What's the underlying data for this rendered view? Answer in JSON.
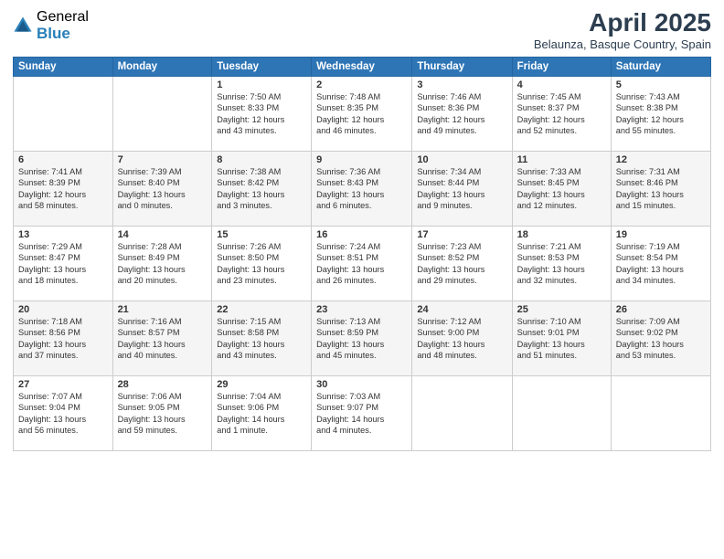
{
  "header": {
    "logo_general": "General",
    "logo_blue": "Blue",
    "month_year": "April 2025",
    "location": "Belaunza, Basque Country, Spain"
  },
  "weekdays": [
    "Sunday",
    "Monday",
    "Tuesday",
    "Wednesday",
    "Thursday",
    "Friday",
    "Saturday"
  ],
  "weeks": [
    [
      {
        "day": "",
        "info": ""
      },
      {
        "day": "",
        "info": ""
      },
      {
        "day": "1",
        "info": "Sunrise: 7:50 AM\nSunset: 8:33 PM\nDaylight: 12 hours\nand 43 minutes."
      },
      {
        "day": "2",
        "info": "Sunrise: 7:48 AM\nSunset: 8:35 PM\nDaylight: 12 hours\nand 46 minutes."
      },
      {
        "day": "3",
        "info": "Sunrise: 7:46 AM\nSunset: 8:36 PM\nDaylight: 12 hours\nand 49 minutes."
      },
      {
        "day": "4",
        "info": "Sunrise: 7:45 AM\nSunset: 8:37 PM\nDaylight: 12 hours\nand 52 minutes."
      },
      {
        "day": "5",
        "info": "Sunrise: 7:43 AM\nSunset: 8:38 PM\nDaylight: 12 hours\nand 55 minutes."
      }
    ],
    [
      {
        "day": "6",
        "info": "Sunrise: 7:41 AM\nSunset: 8:39 PM\nDaylight: 12 hours\nand 58 minutes."
      },
      {
        "day": "7",
        "info": "Sunrise: 7:39 AM\nSunset: 8:40 PM\nDaylight: 13 hours\nand 0 minutes."
      },
      {
        "day": "8",
        "info": "Sunrise: 7:38 AM\nSunset: 8:42 PM\nDaylight: 13 hours\nand 3 minutes."
      },
      {
        "day": "9",
        "info": "Sunrise: 7:36 AM\nSunset: 8:43 PM\nDaylight: 13 hours\nand 6 minutes."
      },
      {
        "day": "10",
        "info": "Sunrise: 7:34 AM\nSunset: 8:44 PM\nDaylight: 13 hours\nand 9 minutes."
      },
      {
        "day": "11",
        "info": "Sunrise: 7:33 AM\nSunset: 8:45 PM\nDaylight: 13 hours\nand 12 minutes."
      },
      {
        "day": "12",
        "info": "Sunrise: 7:31 AM\nSunset: 8:46 PM\nDaylight: 13 hours\nand 15 minutes."
      }
    ],
    [
      {
        "day": "13",
        "info": "Sunrise: 7:29 AM\nSunset: 8:47 PM\nDaylight: 13 hours\nand 18 minutes."
      },
      {
        "day": "14",
        "info": "Sunrise: 7:28 AM\nSunset: 8:49 PM\nDaylight: 13 hours\nand 20 minutes."
      },
      {
        "day": "15",
        "info": "Sunrise: 7:26 AM\nSunset: 8:50 PM\nDaylight: 13 hours\nand 23 minutes."
      },
      {
        "day": "16",
        "info": "Sunrise: 7:24 AM\nSunset: 8:51 PM\nDaylight: 13 hours\nand 26 minutes."
      },
      {
        "day": "17",
        "info": "Sunrise: 7:23 AM\nSunset: 8:52 PM\nDaylight: 13 hours\nand 29 minutes."
      },
      {
        "day": "18",
        "info": "Sunrise: 7:21 AM\nSunset: 8:53 PM\nDaylight: 13 hours\nand 32 minutes."
      },
      {
        "day": "19",
        "info": "Sunrise: 7:19 AM\nSunset: 8:54 PM\nDaylight: 13 hours\nand 34 minutes."
      }
    ],
    [
      {
        "day": "20",
        "info": "Sunrise: 7:18 AM\nSunset: 8:56 PM\nDaylight: 13 hours\nand 37 minutes."
      },
      {
        "day": "21",
        "info": "Sunrise: 7:16 AM\nSunset: 8:57 PM\nDaylight: 13 hours\nand 40 minutes."
      },
      {
        "day": "22",
        "info": "Sunrise: 7:15 AM\nSunset: 8:58 PM\nDaylight: 13 hours\nand 43 minutes."
      },
      {
        "day": "23",
        "info": "Sunrise: 7:13 AM\nSunset: 8:59 PM\nDaylight: 13 hours\nand 45 minutes."
      },
      {
        "day": "24",
        "info": "Sunrise: 7:12 AM\nSunset: 9:00 PM\nDaylight: 13 hours\nand 48 minutes."
      },
      {
        "day": "25",
        "info": "Sunrise: 7:10 AM\nSunset: 9:01 PM\nDaylight: 13 hours\nand 51 minutes."
      },
      {
        "day": "26",
        "info": "Sunrise: 7:09 AM\nSunset: 9:02 PM\nDaylight: 13 hours\nand 53 minutes."
      }
    ],
    [
      {
        "day": "27",
        "info": "Sunrise: 7:07 AM\nSunset: 9:04 PM\nDaylight: 13 hours\nand 56 minutes."
      },
      {
        "day": "28",
        "info": "Sunrise: 7:06 AM\nSunset: 9:05 PM\nDaylight: 13 hours\nand 59 minutes."
      },
      {
        "day": "29",
        "info": "Sunrise: 7:04 AM\nSunset: 9:06 PM\nDaylight: 14 hours\nand 1 minute."
      },
      {
        "day": "30",
        "info": "Sunrise: 7:03 AM\nSunset: 9:07 PM\nDaylight: 14 hours\nand 4 minutes."
      },
      {
        "day": "",
        "info": ""
      },
      {
        "day": "",
        "info": ""
      },
      {
        "day": "",
        "info": ""
      }
    ]
  ]
}
